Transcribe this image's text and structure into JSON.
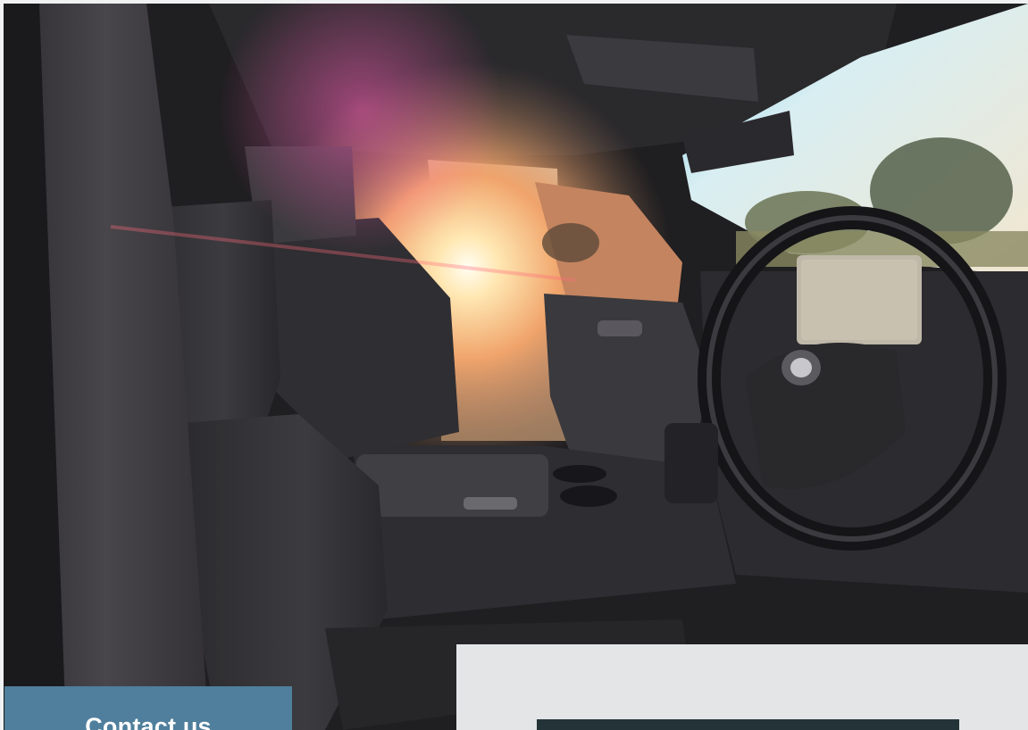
{
  "hero": {
    "description_icon": "car-interior-photo"
  },
  "contact": {
    "label": "Contact us"
  },
  "colors": {
    "contact_tab_bg": "#4f7f9c",
    "panel_bg": "#e3e5e7",
    "panel_strip": "#243337"
  }
}
